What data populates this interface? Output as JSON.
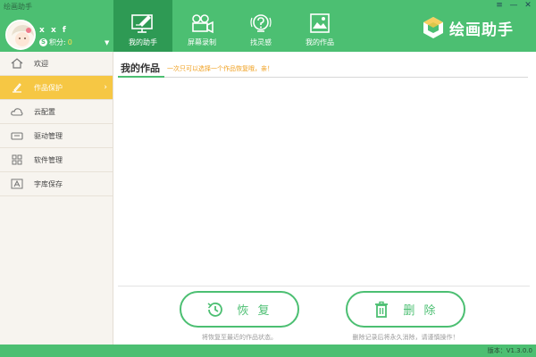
{
  "window": {
    "title": "绘画助手",
    "min_icon": "menu-icon",
    "min": "—",
    "close": "✕"
  },
  "user": {
    "name": "x x f",
    "score_label": "积分:",
    "score_value": "0",
    "badge": "S"
  },
  "nav": [
    {
      "label": "我的助手",
      "icon": "monitor-brush-icon",
      "active": true
    },
    {
      "label": "屏幕录制",
      "icon": "video-camera-icon",
      "active": false
    },
    {
      "label": "找灵感",
      "icon": "question-bulb-icon",
      "active": false
    },
    {
      "label": "我的作品",
      "icon": "picture-frame-icon",
      "active": false
    }
  ],
  "logo": {
    "text": "绘画助手",
    "icon": "cube-logo-icon"
  },
  "sidebar": [
    {
      "label": "欢迎",
      "icon": "home-icon"
    },
    {
      "label": "作品保护",
      "icon": "brush-icon",
      "active": true
    },
    {
      "label": "云配置",
      "icon": "cloud-icon"
    },
    {
      "label": "驱动管理",
      "icon": "tablet-icon"
    },
    {
      "label": "软件管理",
      "icon": "grid-icon"
    },
    {
      "label": "字库保存",
      "icon": "font-icon"
    }
  ],
  "main": {
    "title": "我的作品",
    "hint": "一次只可以选择一个作品恢复哦，亲！",
    "restore": {
      "label": "恢 复",
      "icon": "clock-icon",
      "note": "将恢复至最近的作品状态。"
    },
    "delete": {
      "label": "删 除",
      "icon": "trash-icon",
      "note": "删除记录后将永久消除，请谨慎操作！"
    }
  },
  "status": {
    "version": "版本：V1.3.0.0"
  },
  "colors": {
    "brand": "#4cbf72",
    "brand_dark": "#2e9a54",
    "active": "#f6c744",
    "hint": "#f0a020"
  }
}
